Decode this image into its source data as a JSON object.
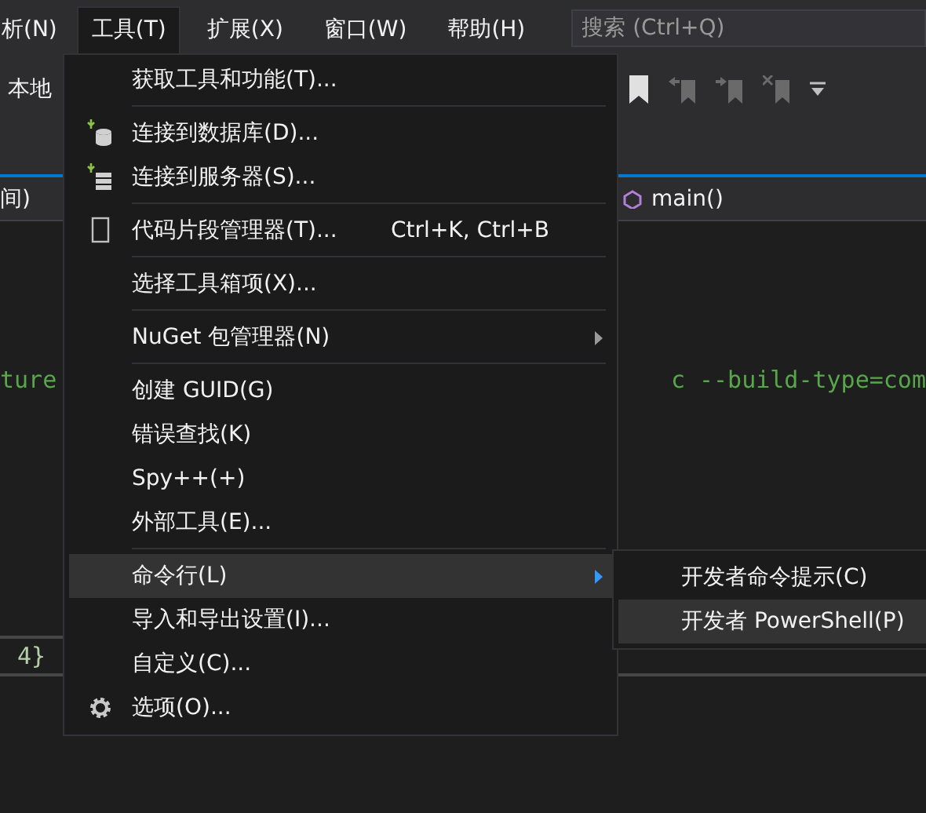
{
  "menubar": {
    "items": [
      {
        "label": "析(N)",
        "selected": false
      },
      {
        "label": "工具(T)",
        "selected": true
      },
      {
        "label": "扩展(X)",
        "selected": false
      },
      {
        "label": "窗口(W)",
        "selected": false
      },
      {
        "label": "帮助(H)",
        "selected": false
      }
    ],
    "search": {
      "placeholder": "搜索 (Ctrl+Q)"
    }
  },
  "toolbar": {
    "label": "本地"
  },
  "navbar": {
    "left": "间)",
    "member": "main()"
  },
  "editor": {
    "lines": [
      {
        "left": "ture",
        "right": "c --build-type=com",
        "current": false
      },
      {
        "left": "4}",
        "current": true
      }
    ]
  },
  "menu": {
    "items": [
      {
        "kind": "item",
        "label": "获取工具和功能(T)...",
        "selected": false
      },
      {
        "kind": "separator"
      },
      {
        "kind": "item",
        "label": "连接到数据库(D)...",
        "selected": false
      },
      {
        "kind": "item",
        "label": "连接到服务器(S)...",
        "selected": false
      },
      {
        "kind": "separator"
      },
      {
        "kind": "item",
        "label": "代码片段管理器(T)...",
        "shortcut": "Ctrl+K, Ctrl+B",
        "selected": false
      },
      {
        "kind": "separator"
      },
      {
        "kind": "item",
        "label": "选择工具箱项(X)...",
        "selected": false
      },
      {
        "kind": "separator"
      },
      {
        "kind": "item",
        "label": "NuGet 包管理器(N)",
        "submenu": true,
        "selected": false
      },
      {
        "kind": "separator"
      },
      {
        "kind": "item",
        "label": "创建 GUID(G)",
        "selected": false
      },
      {
        "kind": "item",
        "label": "错误查找(K)",
        "selected": false
      },
      {
        "kind": "item",
        "label": "Spy++(+)",
        "selected": false
      },
      {
        "kind": "item",
        "label": "外部工具(E)...",
        "selected": false
      },
      {
        "kind": "separator"
      },
      {
        "kind": "item",
        "label": "命令行(L)",
        "submenu": true,
        "selected": true
      },
      {
        "kind": "item",
        "label": "导入和导出设置(I)...",
        "selected": false
      },
      {
        "kind": "item",
        "label": "自定义(C)...",
        "selected": false
      },
      {
        "kind": "item",
        "label": "选项(O)...",
        "selected": false
      }
    ]
  },
  "submenu": {
    "items": [
      {
        "label": "开发者命令提示(C)",
        "selected": false
      },
      {
        "label": "开发者 PowerShell(P)",
        "selected": true
      }
    ]
  }
}
